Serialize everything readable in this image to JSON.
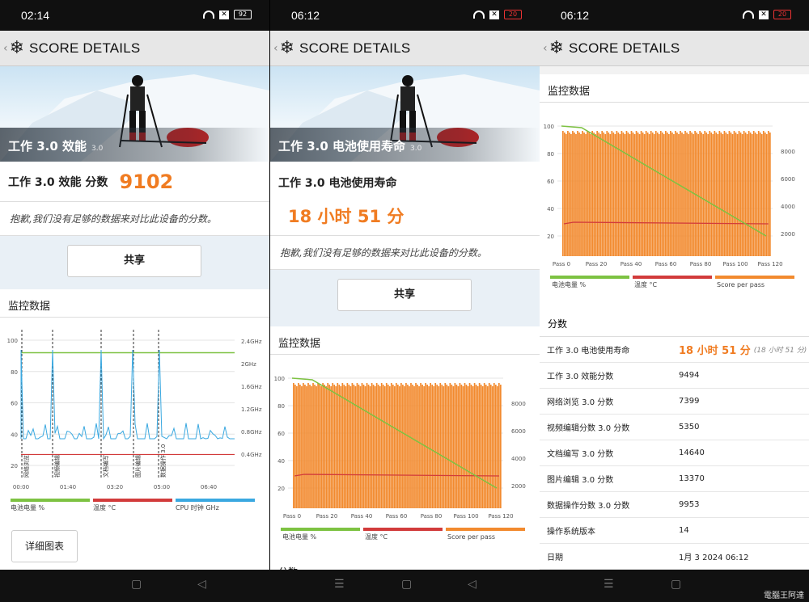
{
  "header_title": "SCORE DETAILS",
  "panels": [
    {
      "time": "02:14",
      "battery": "92",
      "hero_caption": "工作 3.0 效能",
      "hero_version": "3.0",
      "score_label": "工作 3.0 效能 分数",
      "score_value": "9102",
      "sorry": "抱歉,我们没有足够的数据来对比此设备的分数。",
      "share": "共享",
      "monitor": "监控数据",
      "detail": "详细图表"
    },
    {
      "time": "06:12",
      "battery": "20",
      "hero_caption": "工作 3.0 电池使用寿命",
      "hero_version": "3.0",
      "score_label": "工作 3.0 电池使用寿命",
      "score_value": "18 小时 51 分",
      "sorry": "抱歉,我们没有足够的数据来对比此设备的分数。",
      "share": "共享",
      "monitor": "监控数据",
      "scores_head": "分数"
    },
    {
      "time": "06:12",
      "battery": "20",
      "monitor": "监控数据",
      "scores_head": "分数"
    }
  ],
  "chart1": {
    "type": "line",
    "x_ticks": [
      "00:00",
      "01:40",
      "03:20",
      "05:00",
      "06:40"
    ],
    "y_left_ticks": [
      "100",
      "80",
      "60",
      "40",
      "20"
    ],
    "y_right_ticks": [
      "2.4GHz",
      "2GHz",
      "1.6GHz",
      "1.2GHz",
      "0.8GHz",
      "0.4GHz"
    ],
    "markers": [
      "网络浏览",
      "视频编辑",
      "文档编写",
      "图片编辑",
      "数据操作 3.0"
    ],
    "legend": [
      "电池电量 %",
      "温度 °C",
      "CPU 时钟 GHz"
    ],
    "colors": {
      "battery": "#7dc242",
      "temp": "#d23b3b",
      "cpu": "#3aa8e0"
    },
    "battery_level": 92,
    "temperature_level": 27
  },
  "chart2": {
    "type": "bar",
    "x_ticks": [
      "Pass 0",
      "Pass 20",
      "Pass 40",
      "Pass 60",
      "Pass 80",
      "Pass 100",
      "Pass 120"
    ],
    "y_left_ticks": [
      "100",
      "80",
      "60",
      "40",
      "20"
    ],
    "y_right_ticks": [
      "8000",
      "6000",
      "4000",
      "2000"
    ],
    "legend": [
      "电池电量 %",
      "温度 °C",
      "Score per pass"
    ],
    "colors": {
      "battery": "#7dc242",
      "temp": "#d23b3b",
      "score": "#f28a2e"
    },
    "battery_start": 100,
    "battery_end": 20,
    "temperature_level": 30,
    "score_per_pass": 9000
  },
  "scores": [
    {
      "k": "工作 3.0 电池使用寿命",
      "v": "18 小时 51 分",
      "v2": "(18 小时 51 分)"
    },
    {
      "k": "工作 3.0 效能分数",
      "v": "9494"
    },
    {
      "k": "网络浏览 3.0 分数",
      "v": "7399"
    },
    {
      "k": "视频编辑分数 3.0 分数",
      "v": "5350"
    },
    {
      "k": "文档编写 3.0 分数",
      "v": "14640"
    },
    {
      "k": "图片编辑 3.0 分数",
      "v": "13370"
    },
    {
      "k": "数据操作分数 3.0 分数",
      "v": "9953"
    },
    {
      "k": "操作系统版本",
      "v": "14"
    },
    {
      "k": "日期",
      "v": "1月 3 2024 06:12"
    }
  ],
  "watermark": "電腦王阿達"
}
